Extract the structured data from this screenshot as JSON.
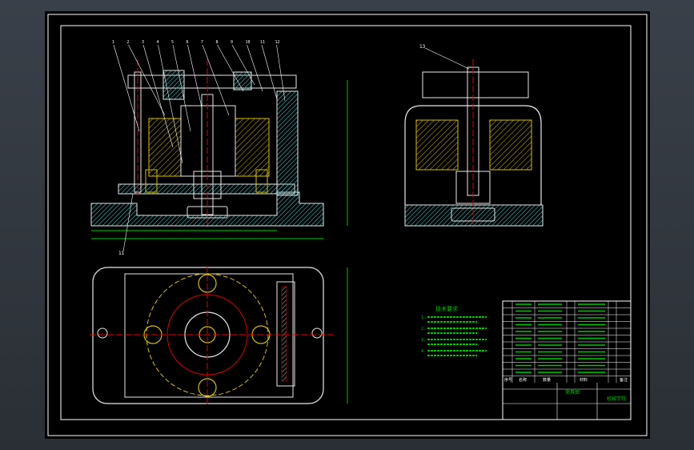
{
  "colors": {
    "background": "#000000",
    "frame": "#ffffff",
    "part_outline": "#e8e8e8",
    "hatch_cyan": "#3ec8c8",
    "hatch_yellow": "#d7c000",
    "dimension_green": "#00c800",
    "centerline_red": "#e00000",
    "leader_white": "#ffffff"
  },
  "front_view": {
    "balloons": [
      "1",
      "2",
      "3",
      "4",
      "5",
      "6",
      "7",
      "8",
      "9",
      "10",
      "11",
      "12"
    ],
    "bottom_balloon": "11"
  },
  "side_view": {
    "balloon": "13"
  },
  "tech_requirements": {
    "title": "技术要求",
    "lines": [
      "1.",
      "2.",
      "3.",
      "4."
    ]
  },
  "title_block": {
    "header_cells": [
      "序号",
      "名称",
      "数量",
      "材料",
      "备注"
    ],
    "name_cell": "夹具图",
    "company_cell": "机械学院"
  }
}
